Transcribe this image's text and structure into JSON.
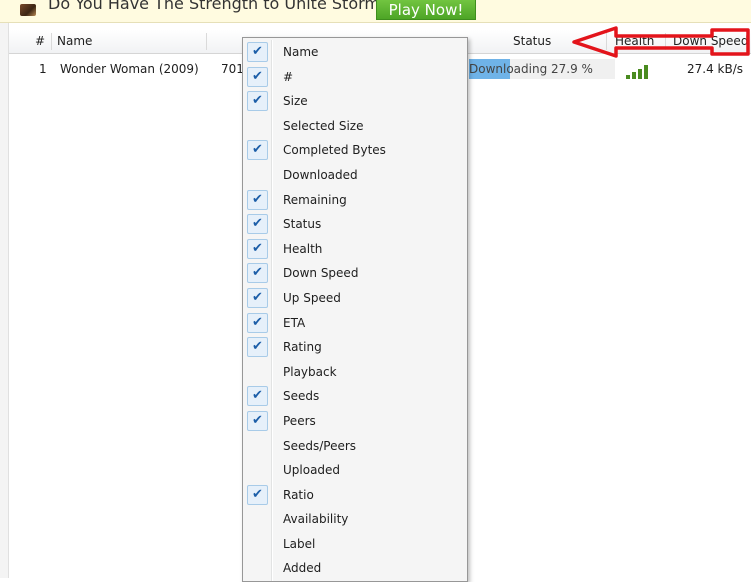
{
  "ad": {
    "text": "Do You Have The Strength to Unite StormFall?",
    "button": "Play Now!"
  },
  "columns": {
    "num": "#",
    "name": "Name",
    "status": "Status",
    "health": "Health",
    "down_speed": "Down Speed"
  },
  "torrent": {
    "index": "1",
    "name": "Wonder Woman (2009)",
    "size_partial": "701",
    "status_text": "Downloading 27.9 %",
    "progress": 0.279,
    "health_bars": 4,
    "down_speed": "27.4 kB/s"
  },
  "menu": [
    {
      "label": "Name",
      "checked": true
    },
    {
      "label": "#",
      "checked": true
    },
    {
      "label": "Size",
      "checked": true
    },
    {
      "label": "Selected Size",
      "checked": false
    },
    {
      "label": "Completed Bytes",
      "checked": true
    },
    {
      "label": "Downloaded",
      "checked": false
    },
    {
      "label": "Remaining",
      "checked": true
    },
    {
      "label": "Status",
      "checked": true
    },
    {
      "label": "Health",
      "checked": true
    },
    {
      "label": "Down Speed",
      "checked": true
    },
    {
      "label": "Up Speed",
      "checked": true
    },
    {
      "label": "ETA",
      "checked": true
    },
    {
      "label": "Rating",
      "checked": true
    },
    {
      "label": "Playback",
      "checked": false
    },
    {
      "label": "Seeds",
      "checked": true
    },
    {
      "label": "Peers",
      "checked": true
    },
    {
      "label": "Seeds/Peers",
      "checked": false
    },
    {
      "label": "Uploaded",
      "checked": false
    },
    {
      "label": "Ratio",
      "checked": true
    },
    {
      "label": "Availability",
      "checked": false
    },
    {
      "label": "Label",
      "checked": false
    },
    {
      "label": "Added",
      "checked": false
    }
  ],
  "colors": {
    "annotation_arrow": "#e3141b",
    "progress_fill": "#6fb3e8",
    "health_bar": "#4a8b1f"
  }
}
